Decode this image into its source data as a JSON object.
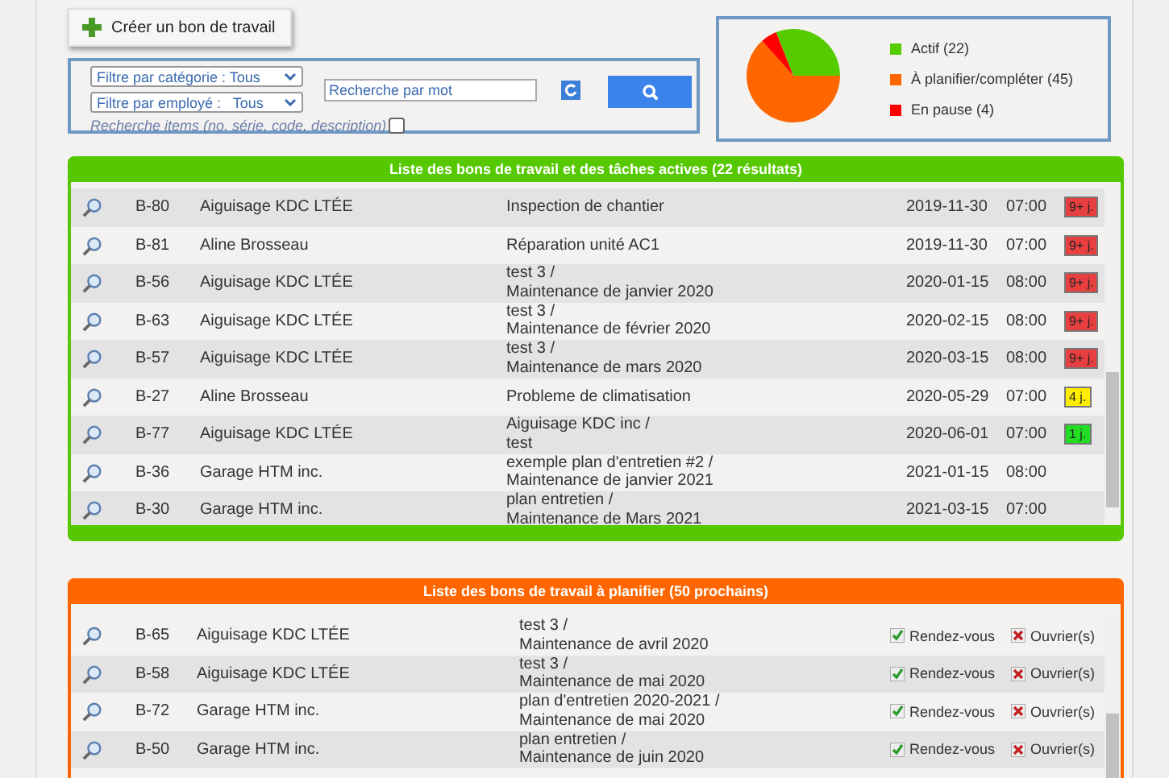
{
  "create_button": {
    "label": "Créer un bon de travail"
  },
  "filters": {
    "category": "Filtre par catégorie : Tous",
    "employee": "Filtre par employé :   Tous",
    "search": {
      "placeholder": "Recherche par mot"
    },
    "items_search": {
      "label": "Recherche items (no. série, code, description)",
      "checked": false
    }
  },
  "status_chart": {
    "chart_data": {
      "type": "pie",
      "categories": [
        "Actif (22)",
        "À planifier/compléter (45)",
        "En pause (4)"
      ],
      "values": [
        22,
        45,
        4
      ],
      "colors": [
        "#55cc00",
        "#ff6600",
        "#ff0000"
      ]
    }
  },
  "active_list": {
    "title": "Liste des bons de travail et des tâches actives (22 résultats)",
    "rows": [
      {
        "id": "B-80",
        "client": "Aiguisage KDC LTÉE",
        "description": [
          "Inspection de chantier"
        ],
        "date": "2019-11-30",
        "time": "07:00",
        "badge": {
          "text": "9+ j.",
          "color": "#e84040"
        }
      },
      {
        "id": "B-81",
        "client": "Aline Brosseau",
        "description": [
          "Réparation unité AC1"
        ],
        "date": "2019-11-30",
        "time": "07:00",
        "badge": {
          "text": "9+ j.",
          "color": "#e84040"
        }
      },
      {
        "id": "B-56",
        "client": "Aiguisage KDC LTÉE",
        "description": [
          "test 3 /",
          "Maintenance de janvier 2020"
        ],
        "date": "2020-01-15",
        "time": "08:00",
        "badge": {
          "text": "9+ j.",
          "color": "#e84040"
        }
      },
      {
        "id": "B-63",
        "client": "Aiguisage KDC LTÉE",
        "description": [
          "test 3 /",
          "Maintenance de février 2020"
        ],
        "date": "2020-02-15",
        "time": "08:00",
        "badge": {
          "text": "9+ j.",
          "color": "#e84040"
        }
      },
      {
        "id": "B-57",
        "client": "Aiguisage KDC LTÉE",
        "description": [
          "test 3 /",
          "Maintenance de mars 2020"
        ],
        "date": "2020-03-15",
        "time": "08:00",
        "badge": {
          "text": "9+ j.",
          "color": "#e84040"
        }
      },
      {
        "id": "B-27",
        "client": "Aline Brosseau",
        "description": [
          "Probleme de climatisation"
        ],
        "date": "2020-05-29",
        "time": "07:00",
        "badge": {
          "text": "4 j.",
          "color": "#ffee00"
        }
      },
      {
        "id": "B-77",
        "client": "Aiguisage KDC LTÉE",
        "description": [
          "Aiguisage KDC inc /",
          "test"
        ],
        "date": "2020-06-01",
        "time": "07:00",
        "badge": {
          "text": "1 j.",
          "color": "#22dd22"
        }
      },
      {
        "id": "B-36",
        "client": "Garage HTM inc.",
        "description": [
          "exemple plan d'entretien #2 /",
          "Maintenance de janvier 2021"
        ],
        "date": "2021-01-15",
        "time": "08:00"
      },
      {
        "id": "B-30",
        "client": "Garage HTM inc.",
        "description": [
          "plan entretien /",
          "Maintenance de Mars 2021"
        ],
        "date": "2021-03-15",
        "time": "07:00"
      }
    ]
  },
  "planning_list": {
    "title": "Liste des bons de travail à planifier (50 prochains)",
    "rows": [
      {
        "id": "B-65",
        "client": "Aiguisage KDC LTÉE",
        "description": [
          "test 3 /",
          "Maintenance de avril 2020"
        ],
        "appointment": {
          "label": "Rendez-vous",
          "done": true
        },
        "workers": {
          "label": "Ouvrier(s)",
          "done": false
        }
      },
      {
        "id": "B-58",
        "client": "Aiguisage KDC LTÉE",
        "description": [
          "test 3 /",
          "Maintenance de mai 2020"
        ],
        "appointment": {
          "label": "Rendez-vous",
          "done": true
        },
        "workers": {
          "label": "Ouvrier(s)",
          "done": false
        }
      },
      {
        "id": "B-72",
        "client": "Garage HTM inc.",
        "description": [
          "plan d'entretien 2020-2021 /",
          "Maintenance de mai 2020"
        ],
        "appointment": {
          "label": "Rendez-vous",
          "done": true
        },
        "workers": {
          "label": "Ouvrier(s)",
          "done": false
        }
      },
      {
        "id": "B-50",
        "client": "Garage HTM inc.",
        "description": [
          "plan entretien /",
          "Maintenance de juin 2020"
        ],
        "appointment": {
          "label": "Rendez-vous",
          "done": true
        },
        "workers": {
          "label": "Ouvrier(s)",
          "done": false
        }
      }
    ]
  }
}
